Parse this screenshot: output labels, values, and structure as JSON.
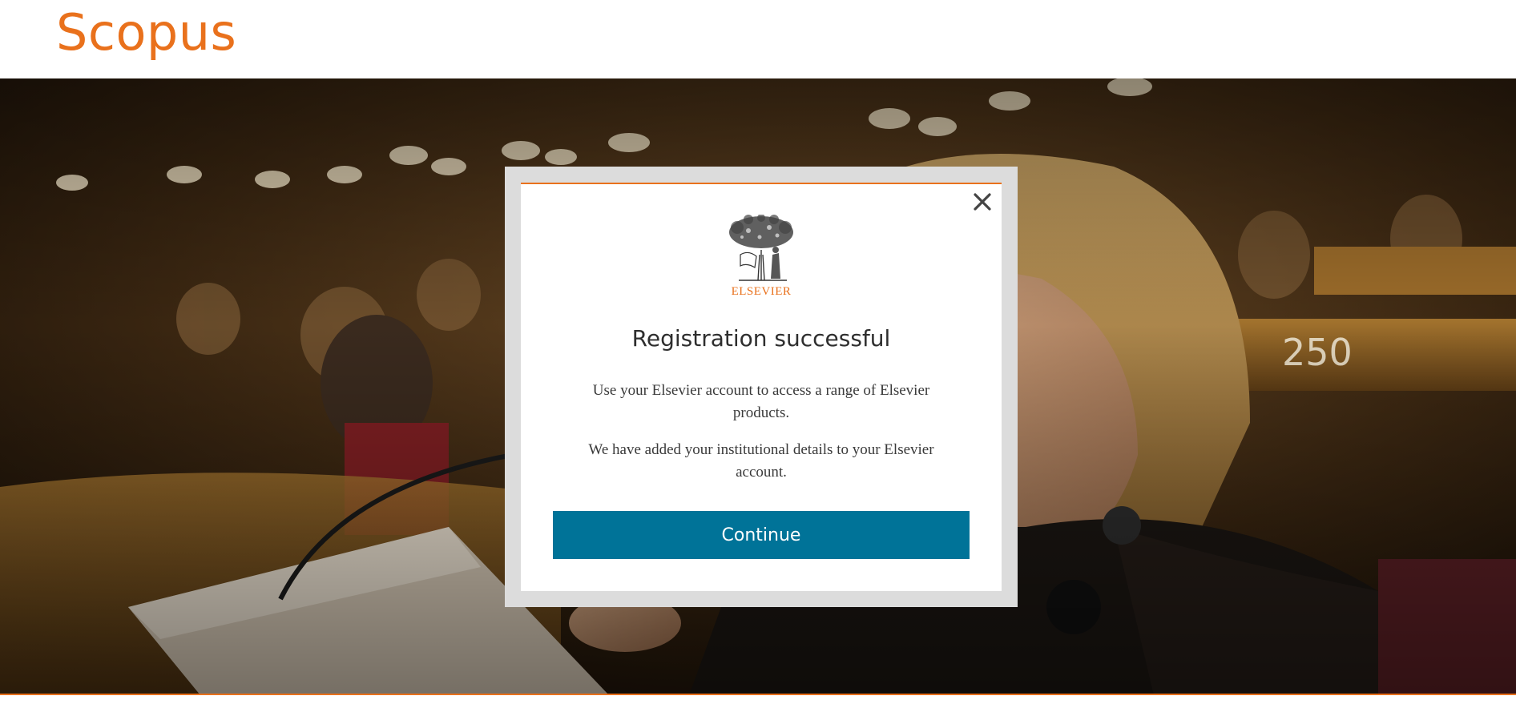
{
  "header": {
    "logo": "Scopus"
  },
  "modal": {
    "publisher": "ELSEVIER",
    "title": "Registration successful",
    "paragraph_1": "Use your Elsevier account to access a range of Elsevier products.",
    "paragraph_2": "We have added your institutional details to your Elsevier account.",
    "continue_label": "Continue",
    "close_icon": "close-icon"
  },
  "colors": {
    "brand_orange": "#e9711c",
    "button_blue": "#007398",
    "modal_frame": "#dcdcdc"
  }
}
